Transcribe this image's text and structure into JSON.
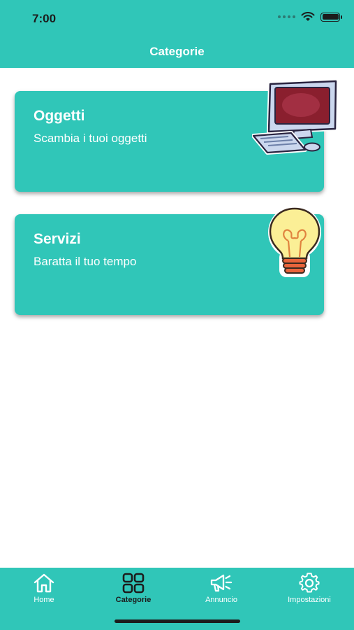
{
  "status_bar": {
    "time": "7:00"
  },
  "header": {
    "title": "Categorie"
  },
  "categories": [
    {
      "title": "Oggetti",
      "subtitle": "Scambia i tuoi oggetti",
      "illustration": "computer-icon"
    },
    {
      "title": "Servizi",
      "subtitle": "Baratta il tuo tempo",
      "illustration": "lightbulb-icon"
    }
  ],
  "tab_bar": {
    "tabs": [
      {
        "label": "Home",
        "icon": "home-icon",
        "active": false
      },
      {
        "label": "Categorie",
        "icon": "grid-icon",
        "active": true
      },
      {
        "label": "Annuncio",
        "icon": "megaphone-icon",
        "active": false
      },
      {
        "label": "Impostazioni",
        "icon": "gear-icon",
        "active": false
      }
    ]
  },
  "colors": {
    "primary": "#30c6b8",
    "text_light": "#ffffff",
    "text_dark": "#1c1c1c"
  }
}
